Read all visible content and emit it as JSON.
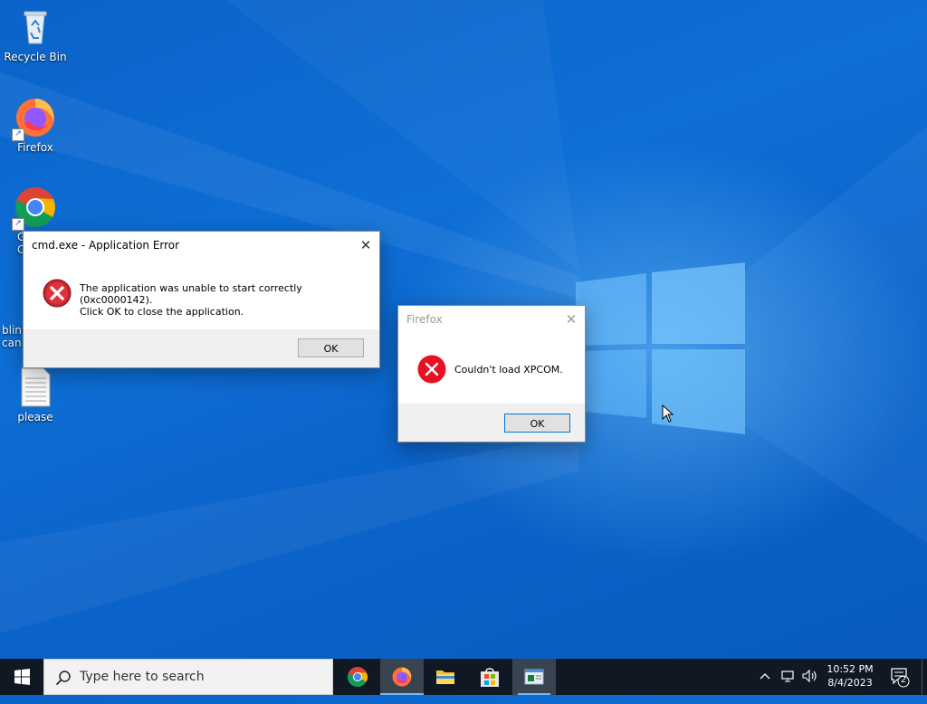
{
  "desktop": {
    "icons": [
      {
        "label": "Recycle Bin",
        "icon": "recycle-bin-icon"
      },
      {
        "label": "Firefox",
        "icon": "firefox-icon"
      },
      {
        "label": "G\nC",
        "icon": "chrome-icon"
      },
      {
        "label": "blin\ncan",
        "icon": "file-icon"
      },
      {
        "label": "please",
        "icon": "text-document-icon"
      }
    ]
  },
  "dialogs": {
    "cmd_error": {
      "title": "cmd.exe - Application Error",
      "message": "The application was unable to start correctly (0xc0000142).\nClick OK to close the application.",
      "ok_label": "OK",
      "icon": "error-icon"
    },
    "firefox_error": {
      "title": "Firefox",
      "message": "Couldn't load XPCOM.",
      "ok_label": "OK",
      "icon": "error-icon"
    }
  },
  "taskbar": {
    "search_placeholder": "Type here to search",
    "apps": [
      {
        "name": "Google Chrome",
        "icon": "chrome-icon"
      },
      {
        "name": "Firefox",
        "icon": "firefox-icon"
      },
      {
        "name": "File Explorer",
        "icon": "folder-icon"
      },
      {
        "name": "Microsoft Store",
        "icon": "store-icon"
      },
      {
        "name": "Application window",
        "icon": "app-window-icon"
      }
    ],
    "clock": {
      "time": "10:52 PM",
      "date": "8/4/2023"
    },
    "notification_count": "2"
  },
  "colors": {
    "desktop_blue": "#0a63c9",
    "taskbar_bg": "#101824",
    "error_red": "#e81123",
    "button_focus_border": "#0078d7"
  }
}
